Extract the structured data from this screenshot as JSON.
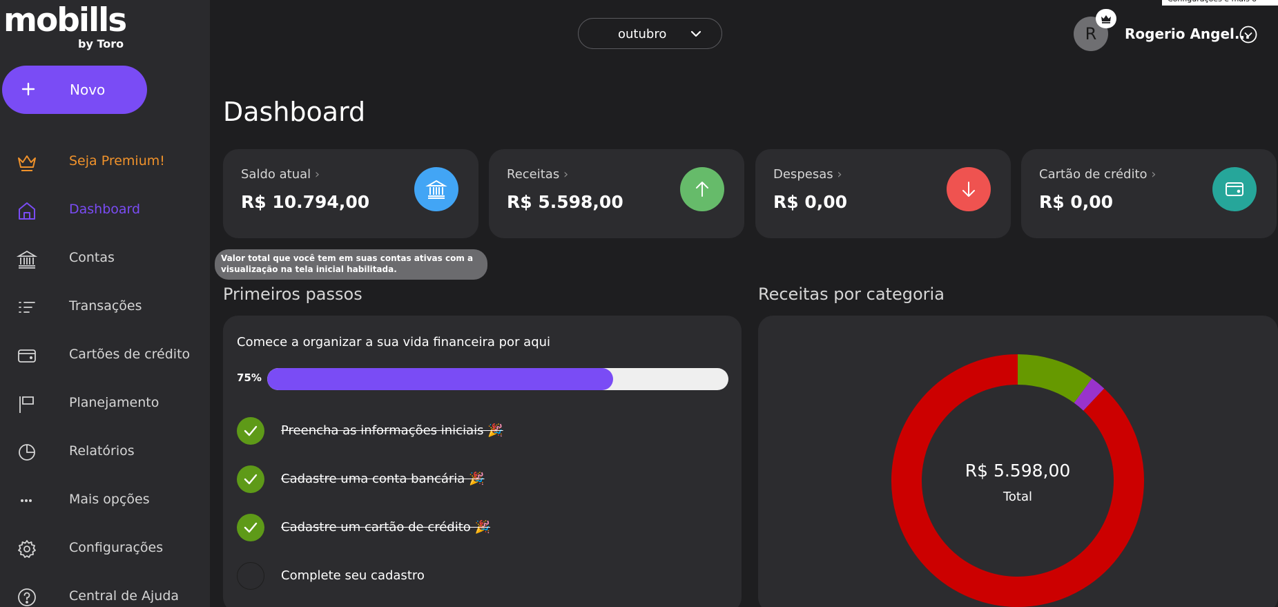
{
  "brand": {
    "name": "mobills",
    "sub": "by Toro"
  },
  "sidebar": {
    "new_label": "Novo",
    "items": [
      {
        "label": "Seja Premium!",
        "icon": "crown-icon"
      },
      {
        "label": "Dashboard",
        "icon": "home-icon"
      },
      {
        "label": "Contas",
        "icon": "bank-icon"
      },
      {
        "label": "Transações",
        "icon": "list-icon"
      },
      {
        "label": "Cartões de crédito",
        "icon": "credit-card-icon"
      },
      {
        "label": "Planejamento",
        "icon": "flag-icon"
      },
      {
        "label": "Relatórios",
        "icon": "pie-chart-icon"
      },
      {
        "label": "Mais opções",
        "icon": "more-icon"
      },
      {
        "label": "Configurações",
        "icon": "gear-icon"
      },
      {
        "label": "Central de Ajuda",
        "icon": "help-icon"
      }
    ]
  },
  "header": {
    "month": "outubro",
    "avatar_initial": "R",
    "user_name": "Rogerio Angel...",
    "corner_tooltip": "Configurações e mais o"
  },
  "page": {
    "title": "Dashboard"
  },
  "cards": [
    {
      "title": "Saldo atual",
      "value": "R$ 10.794,00",
      "icon": "bank-icon",
      "color": "#42a5f5"
    },
    {
      "title": "Receitas",
      "value": "R$ 5.598,00",
      "icon": "arrow-up-icon",
      "color": "#66bb6a"
    },
    {
      "title": "Despesas",
      "value": "R$ 0,00",
      "icon": "arrow-down-icon",
      "color": "#ef5350"
    },
    {
      "title": "Cartão de crédito",
      "value": "R$ 0,00",
      "icon": "credit-card-icon",
      "color": "#26a69a"
    }
  ],
  "tooltip": "Valor total que você tem em suas contas ativas com a visualização na tela inicial habilitada.",
  "primeiros_passos": {
    "title": "Primeiros passos",
    "subtitle": "Comece a organizar a sua vida financeira por aqui",
    "progress_label": "75%",
    "progress": 0.75,
    "steps": [
      {
        "label": "Preencha as informações iniciais 🎉",
        "done": true
      },
      {
        "label": "Cadastre uma conta bancária 🎉",
        "done": true
      },
      {
        "label": "Cadastre um cartão de crédito 🎉",
        "done": true
      },
      {
        "label": "Complete seu cadastro",
        "done": false
      }
    ]
  },
  "receitas_categoria": {
    "title": "Receitas por categoria",
    "total_value": "R$ 5.598,00",
    "total_label": "Total"
  },
  "chart_data": {
    "type": "pie",
    "title": "Receitas por categoria",
    "categories": [
      "",
      "",
      ""
    ],
    "values": [
      0.1,
      0.02,
      0.88
    ],
    "colors": [
      "#669900",
      "#9933cc",
      "#cc0000"
    ]
  },
  "colors": {
    "accent": "#7a4cf5",
    "premium": "#f0922b",
    "sidebar": "#2a2a2d",
    "background": "#1e1e20",
    "card": "#2c2c2f"
  }
}
